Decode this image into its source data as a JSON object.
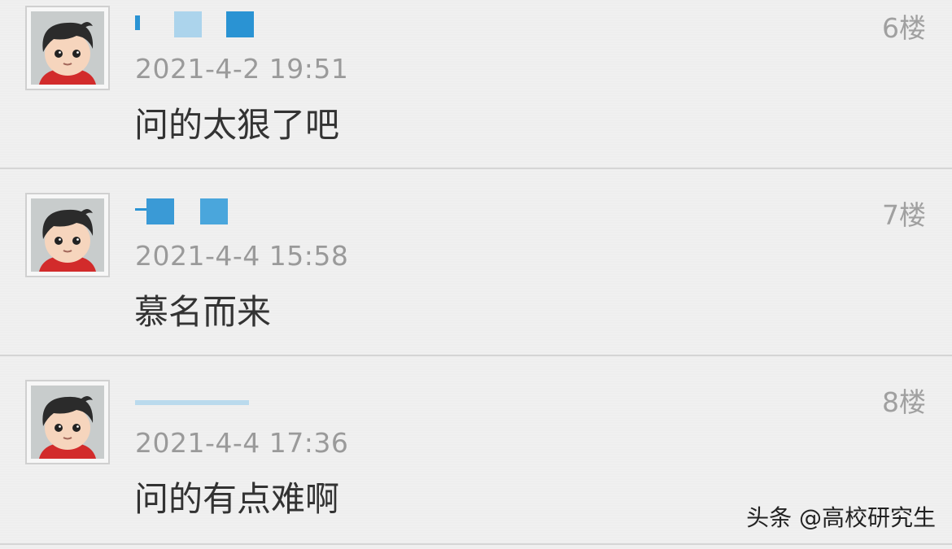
{
  "comments": [
    {
      "floor": "6楼",
      "time": "2021-4-2 19:51",
      "text": "问的太狠了吧"
    },
    {
      "floor": "7楼",
      "time": "2021-4-4 15:58",
      "text": "慕名而来"
    },
    {
      "floor": "8楼",
      "time": "2021-4-4 17:36",
      "text": "问的有点难啊"
    }
  ],
  "watermark": "头条 @高校研究生",
  "colors": {
    "username_blur_light": "#acd4ec",
    "username_blur_dark": "#2a93d3",
    "time_text": "#9a9a9a",
    "body_text": "#333333"
  },
  "icons": {
    "avatar": "cartoon-boy-avatar-icon"
  }
}
